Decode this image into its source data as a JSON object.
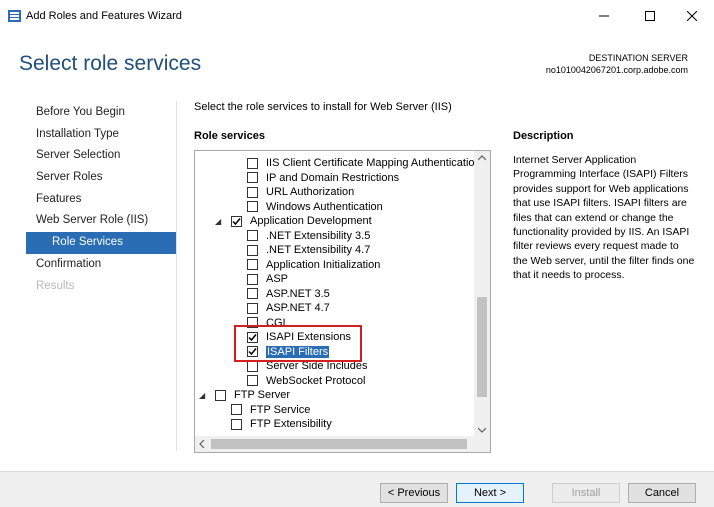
{
  "window": {
    "title": "Add Roles and Features Wizard"
  },
  "header": {
    "page_title": "Select role services",
    "destination_label": "DESTINATION SERVER",
    "destination_host": "no1010042067201.corp.adobe.com"
  },
  "nav": {
    "items": [
      {
        "label": "Before You Begin",
        "state": "normal"
      },
      {
        "label": "Installation Type",
        "state": "normal"
      },
      {
        "label": "Server Selection",
        "state": "normal"
      },
      {
        "label": "Server Roles",
        "state": "normal"
      },
      {
        "label": "Features",
        "state": "normal"
      },
      {
        "label": "Web Server Role (IIS)",
        "state": "normal"
      },
      {
        "label": "Role Services",
        "state": "active"
      },
      {
        "label": "Confirmation",
        "state": "normal"
      },
      {
        "label": "Results",
        "state": "disabled"
      }
    ]
  },
  "content": {
    "instruction": "Select the role services to install for Web Server (IIS)",
    "role_services_label": "Role services",
    "description_label": "Description",
    "description_text": "Internet Server Application Programming Interface (ISAPI) Filters provides support for Web applications that use ISAPI filters. ISAPI filters are files that can extend or change the functionality provided by IIS. An ISAPI filter reviews every request made to the Web server, until the filter finds one that it needs to process."
  },
  "tree": {
    "items": [
      {
        "label": "IIS Client Certificate Mapping Authentication",
        "checked": false
      },
      {
        "label": "IP and Domain Restrictions",
        "checked": false
      },
      {
        "label": "URL Authorization",
        "checked": false
      },
      {
        "label": "Windows Authentication",
        "checked": false
      },
      {
        "label": "Application Development",
        "checked": true
      },
      {
        "label": ".NET Extensibility 3.5",
        "checked": false
      },
      {
        "label": ".NET Extensibility 4.7",
        "checked": false
      },
      {
        "label": "Application Initialization",
        "checked": false
      },
      {
        "label": "ASP",
        "checked": false
      },
      {
        "label": "ASP.NET 3.5",
        "checked": false
      },
      {
        "label": "ASP.NET 4.7",
        "checked": false
      },
      {
        "label": "CGI",
        "checked": false
      },
      {
        "label": "ISAPI Extensions",
        "checked": true
      },
      {
        "label": "ISAPI Filters",
        "checked": true
      },
      {
        "label": "Server Side Includes",
        "checked": false
      },
      {
        "label": "WebSocket Protocol",
        "checked": false
      },
      {
        "label": "FTP Server",
        "checked": false
      },
      {
        "label": "FTP Service",
        "checked": false
      },
      {
        "label": "FTP Extensibility",
        "checked": false
      }
    ]
  },
  "buttons": {
    "previous": "< Previous",
    "next": "Next >",
    "install": "Install",
    "cancel": "Cancel"
  },
  "colors": {
    "accent": "#2a6db5",
    "title": "#1f4f7a",
    "highlight": "#d21f1f"
  }
}
